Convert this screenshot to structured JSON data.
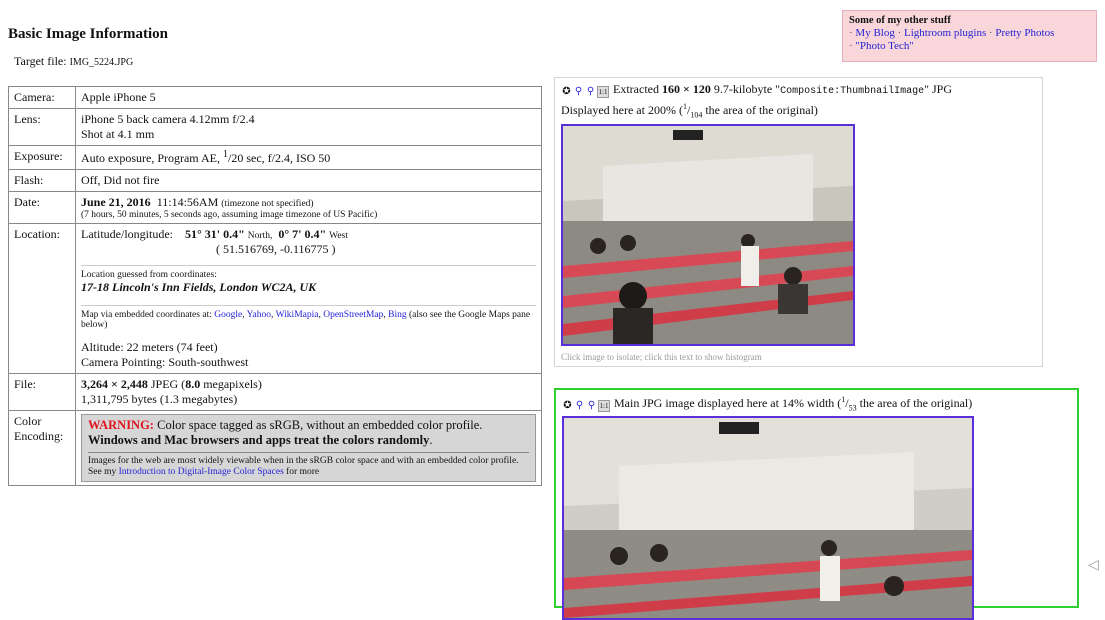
{
  "page": {
    "title": "Basic Image Information",
    "target_label": "Target file:",
    "target_file": "IMG_5224.JPG"
  },
  "promo": {
    "heading": "Some of my other stuff",
    "links": [
      "My Blog",
      "Lightroom plugins",
      "Pretty Photos",
      "\"Photo Tech\""
    ]
  },
  "info": {
    "camera": {
      "label": "Camera:",
      "value": "Apple iPhone 5"
    },
    "lens": {
      "label": "Lens:",
      "line1": "iPhone 5 back camera 4.12mm f/2.4",
      "line2": "Shot at 4.1 mm"
    },
    "exposure": {
      "label": "Exposure:",
      "pre": "Auto exposure, Program AE, ",
      "num": "1",
      "post": "/20 sec, f/2.4, ISO 50"
    },
    "flash": {
      "label": "Flash:",
      "value": "Off, Did not fire"
    },
    "date": {
      "label": "Date:",
      "date": "June 21, 2016",
      "time": "11:14:56AM",
      "tz": "(timezone not specified)",
      "ago": "(7 hours, 50 minutes, 5 seconds ago, assuming image timezone of US Pacific)"
    },
    "location": {
      "label": "Location:",
      "latlong_label": "Latitude/longitude:",
      "lat": "51° 31' 0.4\"",
      "lat_dir": "North,",
      "lon": "0° 7' 0.4\"",
      "lon_dir": "West",
      "decimal": "( 51.516769, -0.116775 )",
      "guess_label": "Location guessed from coordinates:",
      "guess": "17-18 Lincoln's Inn Fields, London WC2A, UK",
      "map_pre": "Map via embedded coordinates at:",
      "map_links": [
        "Google",
        "Yahoo",
        "WikiMapia",
        "OpenStreetMap",
        "Bing"
      ],
      "map_post": "(also see the Google Maps pane below)",
      "altitude": "Altitude: 22 meters (74 feet)",
      "pointing": "Camera Pointing: South-southwest"
    },
    "file": {
      "label": "File:",
      "dims": "3,264 × 2,448",
      "mid": " JPEG (",
      "mp": "8.0",
      "post": " megapixels)",
      "bytes": "1,311,795 bytes (1.3 megabytes)"
    },
    "color": {
      "label": "Color Encoding:",
      "warn": "WARNING:",
      "warn_text": " Color space tagged as sRGB, without an embedded color profile.",
      "warn_bold": " Windows and Mac browsers and apps treat the colors randomly",
      "period": ".",
      "note_pre": "Images for the web are most widely viewable when in the sRGB color space and with an embedded color profile. See my ",
      "note_link": "Introduction to Digital-Image Color Spaces",
      "note_post": " for more"
    }
  },
  "thumb": {
    "pre": "Extracted ",
    "dims": "160 × 120",
    "mid": " 9.7-kilobyte \"",
    "tag": "Composite:ThumbnailImage",
    "post": "\" JPG",
    "line2_pre": "Displayed here at 200% (",
    "frac_num": "1",
    "frac_den": "104",
    "line2_post": " the area of the original)",
    "caption": "Click image to isolate; click this text to show histogram"
  },
  "main": {
    "text": "Main JPG image displayed here at 14% width (",
    "frac_num": "1",
    "frac_den": "53",
    "post": " the area of the original)"
  },
  "icons": [
    "pin-icon",
    "magnify-icon",
    "magnify-icon",
    "one-to-one-icon"
  ]
}
